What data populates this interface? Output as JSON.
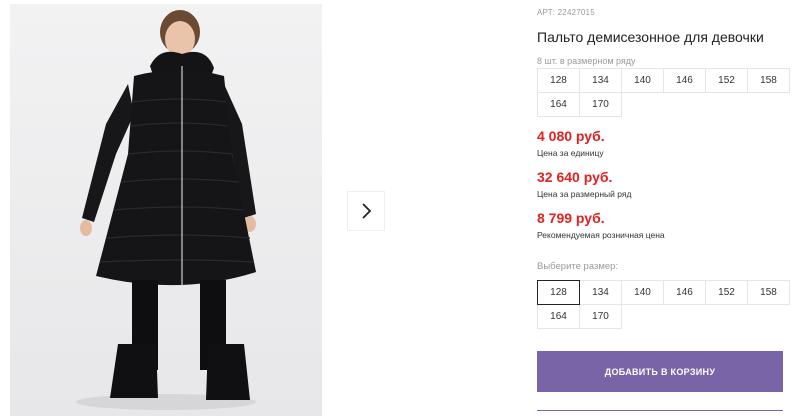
{
  "product": {
    "article": "АРТ: 22427015",
    "title": "Пальто демисезонное для девочки"
  },
  "pack": {
    "hint": "8 шт. в размерном ряду",
    "sizes": [
      "128",
      "134",
      "140",
      "146",
      "152",
      "158",
      "164",
      "170"
    ]
  },
  "prices": {
    "unit_value": "4 080 руб.",
    "unit_caption": "Цена за единицу",
    "row_value": "32 640 руб.",
    "row_caption": "Цена за размерный ряд",
    "retail_value": "8 799 руб.",
    "retail_caption": "Рекомендуемая розничная цена"
  },
  "select": {
    "hint": "Выберите размер:",
    "sizes": [
      "128",
      "134",
      "140",
      "146",
      "152",
      "158",
      "164",
      "170"
    ],
    "selected": "128"
  },
  "actions": {
    "add_to_cart": "Добавить в корзину"
  },
  "colors": {
    "price": "#e0211f",
    "accent": "#7a64a8"
  },
  "icons": {
    "next": "chevron-right-icon"
  }
}
